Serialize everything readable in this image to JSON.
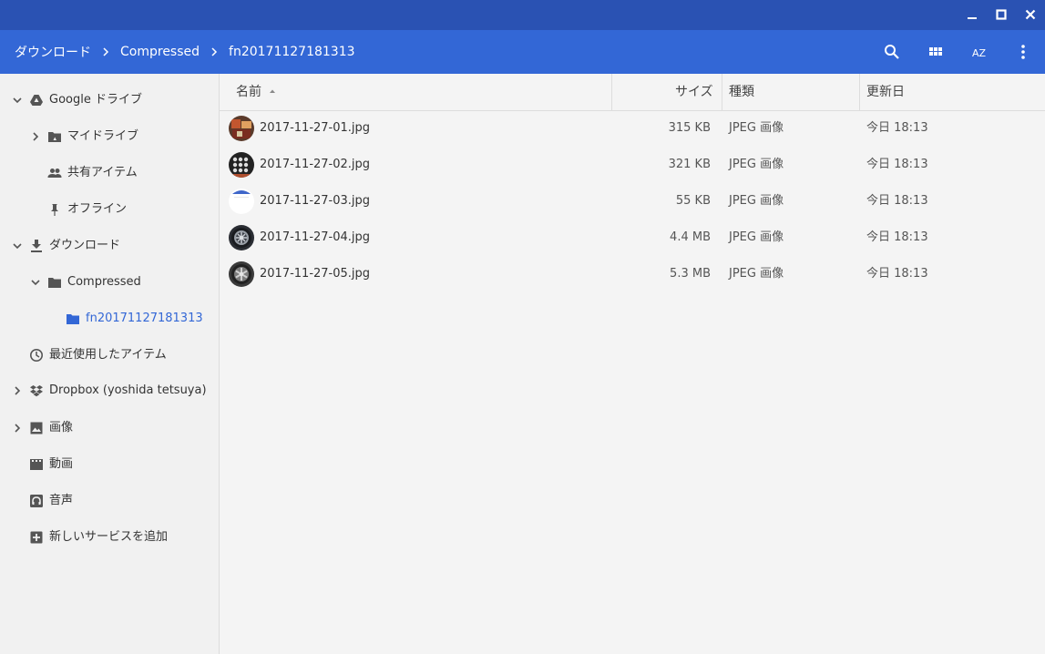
{
  "breadcrumb": [
    "ダウンロード",
    "Compressed",
    "fn20171127181313"
  ],
  "toolbar": {
    "sort_label": "AZ"
  },
  "sidebar": {
    "google_drive": "Google ドライブ",
    "my_drive": "マイドライブ",
    "shared": "共有アイテム",
    "offline": "オフライン",
    "downloads": "ダウンロード",
    "compressed": "Compressed",
    "folder": "fn20171127181313",
    "recent": "最近使用したアイテム",
    "dropbox": "Dropbox (yoshida tetsuya)",
    "images": "画像",
    "videos": "動画",
    "audio": "音声",
    "add_service": "新しいサービスを追加"
  },
  "table": {
    "columns": {
      "name": "名前",
      "size": "サイズ",
      "type": "種類",
      "modified": "更新日"
    },
    "rows": [
      {
        "name": "2017-11-27-01.jpg",
        "size": "315 KB",
        "type": "JPEG 画像",
        "modified": "今日 18:13"
      },
      {
        "name": "2017-11-27-02.jpg",
        "size": "321 KB",
        "type": "JPEG 画像",
        "modified": "今日 18:13"
      },
      {
        "name": "2017-11-27-03.jpg",
        "size": "55 KB",
        "type": "JPEG 画像",
        "modified": "今日 18:13"
      },
      {
        "name": "2017-11-27-04.jpg",
        "size": "4.4 MB",
        "type": "JPEG 画像",
        "modified": "今日 18:13"
      },
      {
        "name": "2017-11-27-05.jpg",
        "size": "5.3 MB",
        "type": "JPEG 画像",
        "modified": "今日 18:13"
      }
    ]
  },
  "colors": {
    "titlebar": "#2a52b3",
    "toolbar": "#3367d6",
    "accent": "#3367d6"
  }
}
